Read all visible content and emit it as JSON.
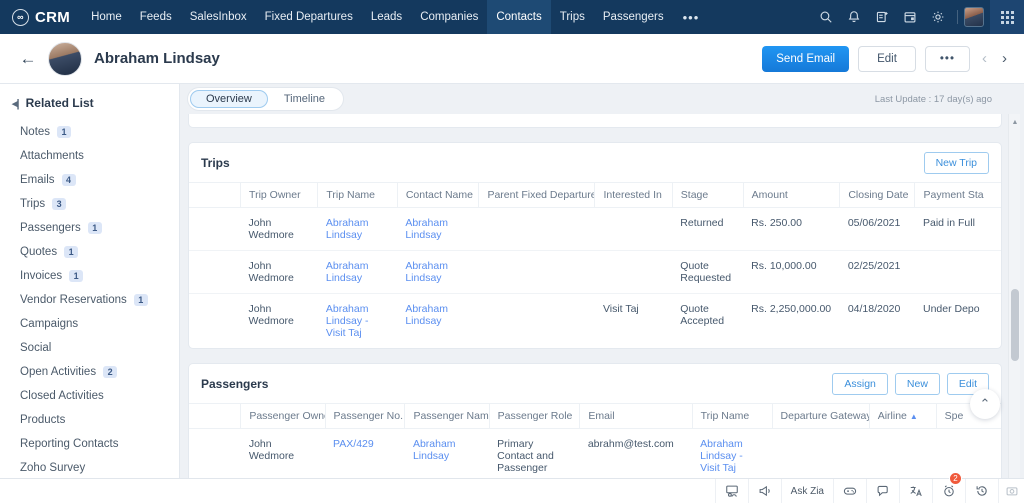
{
  "topnav": {
    "brand": "CRM",
    "items": [
      {
        "label": "Home",
        "active": false
      },
      {
        "label": "Feeds",
        "active": false
      },
      {
        "label": "SalesInbox",
        "active": false
      },
      {
        "label": "Fixed Departures",
        "active": false
      },
      {
        "label": "Leads",
        "active": false
      },
      {
        "label": "Companies",
        "active": false
      },
      {
        "label": "Contacts",
        "active": true
      },
      {
        "label": "Trips",
        "active": false
      },
      {
        "label": "Passengers",
        "active": false
      }
    ],
    "more": "•••",
    "icons": [
      "search-icon",
      "bell-icon",
      "add-note-icon",
      "calendar-icon",
      "gear-icon"
    ]
  },
  "contact_header": {
    "name": "Abraham Lindsay",
    "send_email": "Send Email",
    "edit": "Edit",
    "more": "•••",
    "prev": "‹",
    "next": "›"
  },
  "sidebar": {
    "title": "Related List",
    "items": [
      {
        "label": "Notes",
        "count": "1"
      },
      {
        "label": "Attachments",
        "count": ""
      },
      {
        "label": "Emails",
        "count": "4"
      },
      {
        "label": "Trips",
        "count": "3"
      },
      {
        "label": "Passengers",
        "count": "1"
      },
      {
        "label": "Quotes",
        "count": "1"
      },
      {
        "label": "Invoices",
        "count": "1"
      },
      {
        "label": "Vendor Reservations",
        "count": "1"
      },
      {
        "label": "Campaigns",
        "count": ""
      },
      {
        "label": "Social",
        "count": ""
      },
      {
        "label": "Open Activities",
        "count": "2"
      },
      {
        "label": "Closed Activities",
        "count": ""
      },
      {
        "label": "Products",
        "count": ""
      },
      {
        "label": "Reporting Contacts",
        "count": ""
      },
      {
        "label": "Zoho Survey",
        "count": ""
      }
    ]
  },
  "tabs": {
    "overview": "Overview",
    "timeline": "Timeline",
    "last_update": "Last Update : 17 day(s) ago"
  },
  "trips": {
    "title": "Trips",
    "new_button": "New Trip",
    "columns": [
      "Trip Owner",
      "Trip Name",
      "Contact Name",
      "Parent Fixed Departure",
      "Interested In",
      "Stage",
      "Amount",
      "Closing Date",
      "Payment Sta"
    ],
    "rows": [
      {
        "owner": "John Wedmore",
        "trip_name": "Abraham Lindsay",
        "contact_name": "Abraham Lindsay",
        "parent_fixed_departure": "",
        "interested_in": "",
        "stage": "Returned",
        "amount": "Rs. 250.00",
        "closing_date": "05/06/2021",
        "payment_status": "Paid in Full"
      },
      {
        "owner": "John Wedmore",
        "trip_name": "Abraham Lindsay",
        "contact_name": "Abraham Lindsay",
        "parent_fixed_departure": "",
        "interested_in": "",
        "stage": "Quote Requested",
        "amount": "Rs. 10,000.00",
        "closing_date": "02/25/2021",
        "payment_status": ""
      },
      {
        "owner": "John Wedmore",
        "trip_name": "Abraham Lindsay - Visit Taj",
        "contact_name": "Abraham Lindsay",
        "parent_fixed_departure": "",
        "interested_in": "Visit Taj",
        "stage": "Quote Accepted",
        "amount": "Rs. 2,250,000.00",
        "closing_date": "04/18/2020",
        "payment_status": "Under Depo"
      }
    ]
  },
  "passengers": {
    "title": "Passengers",
    "assign_button": "Assign",
    "new_button": "New",
    "edit_button": "Edit",
    "columns": [
      "Passenger Owner",
      "Passenger No.",
      "Passenger Name",
      "Passenger Role",
      "Email",
      "Trip Name",
      "Departure Gateway",
      "Airline",
      "Spe"
    ],
    "sort_column": "Airline",
    "sort_arrow": "▲",
    "rows": [
      {
        "owner": "John Wedmore",
        "passenger_no": "PAX/429",
        "passenger_name": "Abraham Lindsay",
        "passenger_role": "Primary Contact and Passenger",
        "email": "abrahm@test.com",
        "trip_name": "Abraham Lindsay - Visit Taj",
        "departure_gateway": "",
        "airline": "",
        "special": ""
      }
    ]
  },
  "scroll_top_button": "⌃",
  "bottombar": {
    "items": [
      {
        "name": "presentation-icon",
        "label": ""
      },
      {
        "name": "announcement-icon",
        "label": ""
      },
      {
        "name": "ask-zia",
        "label": "Ask Zia"
      },
      {
        "name": "gamification-icon",
        "label": ""
      },
      {
        "name": "chat-icon",
        "label": ""
      },
      {
        "name": "translate-icon",
        "label": ""
      },
      {
        "name": "alarm-icon",
        "label": "",
        "badge": "2"
      },
      {
        "name": "history-icon",
        "label": ""
      },
      {
        "name": "camera-icon",
        "label": ""
      }
    ]
  }
}
